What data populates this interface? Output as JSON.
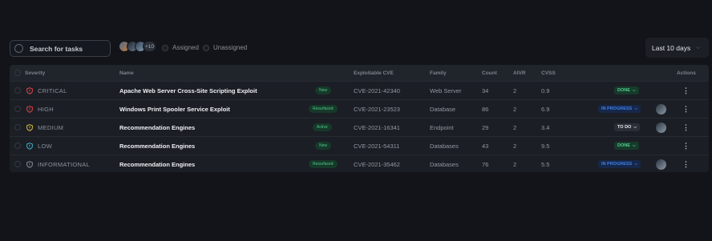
{
  "toolbar": {
    "search_placeholder": "Search for tasks",
    "avatars_more": "+10",
    "filter_assigned": "Assigned",
    "filter_unassigned": "Unassigned",
    "date_range": "Last 10 days"
  },
  "table": {
    "headers": {
      "severity": "Severity",
      "name": "Name",
      "cve": "Exploitable CVE",
      "family": "Family",
      "count": "Count",
      "aivr": "AIVR",
      "cvss": "CVSS",
      "actions": "Actions"
    },
    "rows": [
      {
        "severity": "CRITICAL",
        "severity_color": "#e5484d",
        "name": "Apache Web Server Cross-Site Scripting Exploit",
        "tag": "New",
        "cve": "CVE-2021-42340",
        "family": "Web Server",
        "count": "34",
        "aivr": "2",
        "cvss": "0.9",
        "status": "DONE",
        "status_kind": "done",
        "has_avatar": false
      },
      {
        "severity": "HIGH",
        "severity_color": "#e5484d",
        "name": "Windows Print Spooler Service Exploit",
        "tag": "Resurfaced",
        "cve": "CVE-2021-23523",
        "family": "Database",
        "count": "86",
        "aivr": "2",
        "cvss": "6.9",
        "status": "IN PROGRESS",
        "status_kind": "prog",
        "has_avatar": true
      },
      {
        "severity": "MEDIUM",
        "severity_color": "#e8c547",
        "name": "Recommendation Engines",
        "tag": "Active",
        "cve": "CVE-2021-16341",
        "family": "Endpoint",
        "count": "29",
        "aivr": "2",
        "cvss": "3.4",
        "status": "TO DO",
        "status_kind": "todo",
        "has_avatar": true
      },
      {
        "severity": "LOW",
        "severity_color": "#3fb5c9",
        "name": "Recommendation Engines",
        "tag": "New",
        "cve": "CVE-2021-54311",
        "family": "Databases",
        "count": "43",
        "aivr": "2",
        "cvss": "9.5",
        "status": "DONE",
        "status_kind": "done",
        "has_avatar": false
      },
      {
        "severity": "INFORMATIONAL",
        "severity_color": "#8c919b",
        "name": "Recommendation Engines",
        "tag": "Resurfaced",
        "cve": "CVE-2021-35462",
        "family": "Databases",
        "count": "76",
        "aivr": "2",
        "cvss": "5.5",
        "status": "IN PROGRESS",
        "status_kind": "prog",
        "has_avatar": true
      }
    ]
  },
  "icons": {
    "search": "search-icon",
    "shield": "shield-icon",
    "chevron": "chevron-down-icon",
    "kebab": "more-vertical-icon"
  }
}
